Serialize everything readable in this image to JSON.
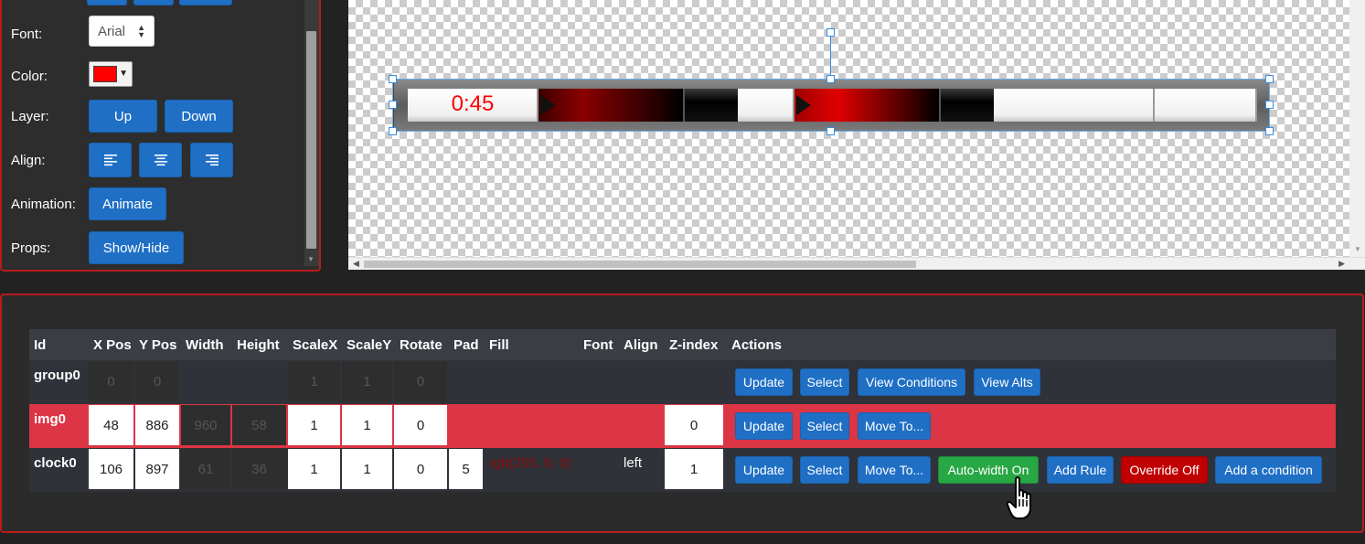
{
  "left_panel": {
    "font_label": "Font:",
    "font_value": "Arial",
    "color_label": "Color:",
    "color_value": "#ff0000",
    "layer_label": "Layer:",
    "layer_up": "Up",
    "layer_down": "Down",
    "align_label": "Align:",
    "align_icons": [
      "align-left-icon",
      "align-center-icon",
      "align-right-icon"
    ],
    "animation_label": "Animation:",
    "animate_button": "Animate",
    "props_label": "Props:",
    "showhide_button": "Show/Hide"
  },
  "canvas": {
    "clock_text": "0:45"
  },
  "table": {
    "headers": [
      "Id",
      "X Pos",
      "Y Pos",
      "Width",
      "Height",
      "ScaleX",
      "ScaleY",
      "Rotate",
      "Pad",
      "Fill",
      "Font",
      "Align",
      "Z-index",
      "Actions"
    ],
    "rows": [
      {
        "id": "group0",
        "x": "0",
        "y": "0",
        "scalex": "1",
        "scaley": "1",
        "rotate": "0",
        "actions": [
          "Update",
          "Select",
          "View Conditions",
          "View Alts"
        ]
      },
      {
        "id": "img0",
        "x": "48",
        "y": "886",
        "width": "960",
        "height": "58",
        "scalex": "1",
        "scaley": "1",
        "rotate": "0",
        "zindex": "0",
        "actions": [
          "Update",
          "Select",
          "Move To..."
        ]
      },
      {
        "id": "clock0",
        "x": "106",
        "y": "897",
        "width": "61",
        "height": "36",
        "scalex": "1",
        "scaley": "1",
        "rotate": "0",
        "pad": "5",
        "fill": "rgb(255, 0, 0)",
        "align": "left",
        "zindex": "1",
        "actions": [
          "Update",
          "Select",
          "Move To...",
          "Auto-width On",
          "Add Rule",
          "Override Off",
          "Add a condition"
        ]
      }
    ]
  },
  "colors": {
    "panel_border": "#b81c1c",
    "primary_button": "#1f6fc5",
    "selected_row": "#dc3545",
    "success_button": "#28a745",
    "danger_button": "#c00000"
  }
}
